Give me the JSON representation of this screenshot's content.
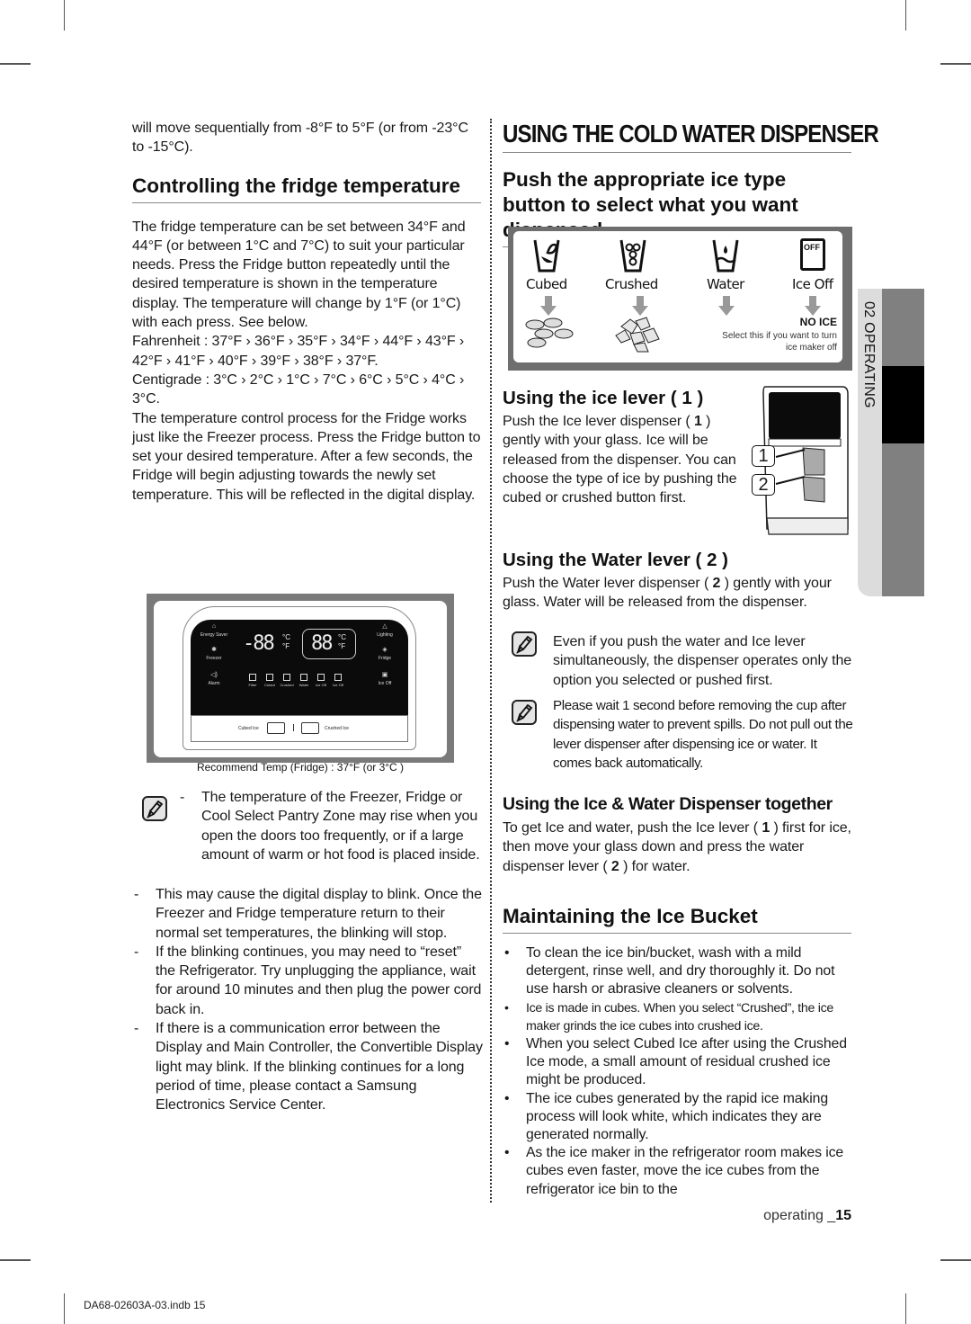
{
  "left": {
    "intro": "will move sequentially from -8°F to 5°F (or from -23°C to -15°C).",
    "heading": "Controlling the fridge temperature",
    "para1": "The fridge temperature can be set between 34°F and 44°F (or between 1°C and 7°C) to suit your particular needs. Press the Fridge button repeatedly until the desired temperature is shown in the temperature display. The temperature will change by 1°F (or 1°C) with each press. See below.",
    "fahrenheit": "Fahrenheit : 37°F  ›  36°F  ›  35°F  ›  34°F  ›  44°F  ›  43°F  ›  42°F  ›  41°F  ›  40°F  ›  39°F  ›  38°F  ›  37°F.",
    "centigrade": "Centigrade : 3°C  ›  2°C  ›  1°C  ›  7°C  ›  6°C  ›  5°C  ›  4°C  ›  3°C.",
    "para2": "The temperature control process for the Fridge works just like the Freezer process. Press the Fridge button to set your desired temperature. After a few seconds, the Fridge will begin adjusting towards the newly set temperature. This will be reflected in the digital display.",
    "panel": {
      "energy_saver": "Energy Saver",
      "freezer": "Freezer",
      "alarm": "Alarm",
      "lighting": "Lighting",
      "fridge": "Fridge",
      "ice_off": "Ice Off",
      "freezer_display": "-88",
      "fridge_display": "88",
      "unit_c": "°C",
      "unit_f": "°F",
      "icons": [
        "Filter",
        "Cubed",
        "Crushed",
        "Water",
        "Ice Off",
        "Ice Off"
      ],
      "cubed_ice": "Cubed Ice",
      "crushed_ice": "Crushed Ice"
    },
    "recommend": "Recommend Temp (Fridge) : 37°F (or 3°C )",
    "notes": [
      "The temperature of the Freezer, Fridge or Cool Select Pantry Zone may rise when you open the doors too frequently, or if a large amount of warm or hot food is placed inside.",
      "This may cause the digital display to blink. Once the Freezer and Fridge temperature return to their normal set temperatures, the blinking will stop.",
      "If the blinking continues, you may need to “reset” the Refrigerator. Try unplugging the appliance, wait for around 10 minutes and then plug the power cord back in.",
      "If there is a communication error between the Display and Main Controller, the Convertible Display light may blink. If the blinking continues for a long period of time, please contact a Samsung Electronics Service Center."
    ]
  },
  "right": {
    "title": "USING THE COLD WATER DISPENSER",
    "subtitle": "Push the appropriate ice type button to select what you want dispensed.",
    "dispenser": {
      "options": [
        "Cubed",
        "Crushed",
        "Water",
        "Ice Off"
      ],
      "off_badge": "OFF",
      "no_ice": "NO ICE",
      "no_ice_desc": "Select this if you want to turn ice maker off"
    },
    "ice_lever": {
      "heading": "Using the ice lever ( 1 )",
      "text_a": "Push the Ice lever dispenser ( ",
      "num": "1",
      "text_b": " ) gently with your glass. Ice will be released from the dispenser. You can choose the type of ice by pushing the cubed or crushed button first.",
      "callout_1": "1",
      "callout_2": "2"
    },
    "water_lever": {
      "heading": "Using the Water lever ( 2 )",
      "text_a": "Push the Water lever dispenser ( ",
      "num": "2",
      "text_b": " ) gently with your glass. Water will be released from the dispenser."
    },
    "notes": [
      "Even if you push the water and Ice lever simultaneously, the dispenser operates only the option you selected or pushed first.",
      "Please wait 1 second before removing the cup after dispensing water to prevent spills. Do not pull out the lever dispenser after dispensing ice or water. It comes back automatically."
    ],
    "together": {
      "heading": "Using the Ice & Water Dispenser together",
      "text_a": "To get Ice and water, push the Ice lever ( ",
      "num1": "1",
      "text_b": " ) first for ice, then move your glass down and press the water dispenser lever ( ",
      "num2": "2",
      "text_c": " ) for water."
    },
    "bucket": {
      "heading": "Maintaining the Ice Bucket",
      "bullets": [
        "To clean the ice bin/bucket, wash with a mild detergent, rinse well, and dry thoroughly it. Do not use harsh or abrasive cleaners or solvents.",
        "Ice is made in cubes. When you select “Crushed”, the ice maker grinds the ice cubes into crushed ice.",
        "When you select Cubed Ice after using the Crushed Ice mode, a small amount of residual crushed ice might be produced.",
        "The ice cubes generated by the rapid ice making process will look white, which indicates they are generated normally.",
        "As the ice maker in the refrigerator room makes ice cubes even faster, move the ice cubes from the refrigerator ice bin to the"
      ]
    }
  },
  "side_tab": "02  OPERATING",
  "footer": {
    "section": "operating _",
    "page": "15",
    "file": "DA68-02603A-03.indb   15"
  }
}
